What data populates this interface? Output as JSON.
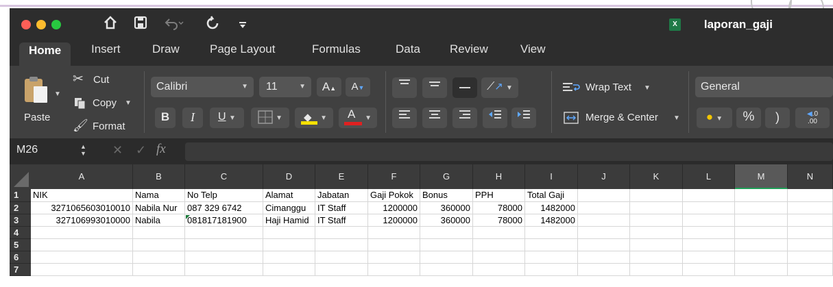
{
  "titlebar": {
    "doc_title": "laporan_gaji",
    "quick_access": [
      "home-icon",
      "save-icon",
      "undo-icon",
      "redo-icon",
      "customize-icon"
    ]
  },
  "tabs": [
    "Home",
    "Insert",
    "Draw",
    "Page Layout",
    "Formulas",
    "Data",
    "Review",
    "View"
  ],
  "clipboard": {
    "paste": "Paste",
    "cut": "Cut",
    "copy": "Copy",
    "format": "Format"
  },
  "font": {
    "family": "Calibri",
    "size": "11",
    "bold": "B",
    "italic": "I",
    "underline": "U",
    "grow": "A",
    "shrink": "A",
    "color": "A"
  },
  "alignment": {
    "wrap_text": "Wrap Text",
    "merge_center": "Merge & Center"
  },
  "number": {
    "format": "General",
    "percent": "%",
    "comma": ")",
    "decimal_inc_top": ".0",
    "decimal_inc_bottom": ".00"
  },
  "formula_bar": {
    "name_box": "M26",
    "fx": "fx"
  },
  "sheet": {
    "columns": [
      "A",
      "B",
      "C",
      "D",
      "E",
      "F",
      "G",
      "H",
      "I",
      "J",
      "K",
      "L",
      "M",
      "N"
    ],
    "row_numbers": [
      "1",
      "2",
      "3",
      "4",
      "5",
      "6",
      "7"
    ],
    "selected_column": "M",
    "header_row": [
      "NIK",
      "Nama",
      "No Telp",
      "Alamat",
      "Jabatan",
      "Gaji Pokok",
      "Bonus",
      "PPH",
      "Total Gaji"
    ],
    "rows": [
      [
        "3271065603010010",
        "Nabila Nur",
        "087 329 6742",
        "Cimanggu",
        "IT Staff",
        "1200000",
        "360000",
        "78000",
        "1482000"
      ],
      [
        "327106993010000",
        "Nabila",
        "081817181900",
        "Haji Hamid",
        "IT Staff",
        "1200000",
        "360000",
        "78000",
        "1482000"
      ]
    ]
  },
  "colors": {
    "title_bg": "#2d2d2d",
    "ribbon_bg": "#404040",
    "accent_green": "#1f9e57",
    "grid_line": "#d6d6d6"
  }
}
